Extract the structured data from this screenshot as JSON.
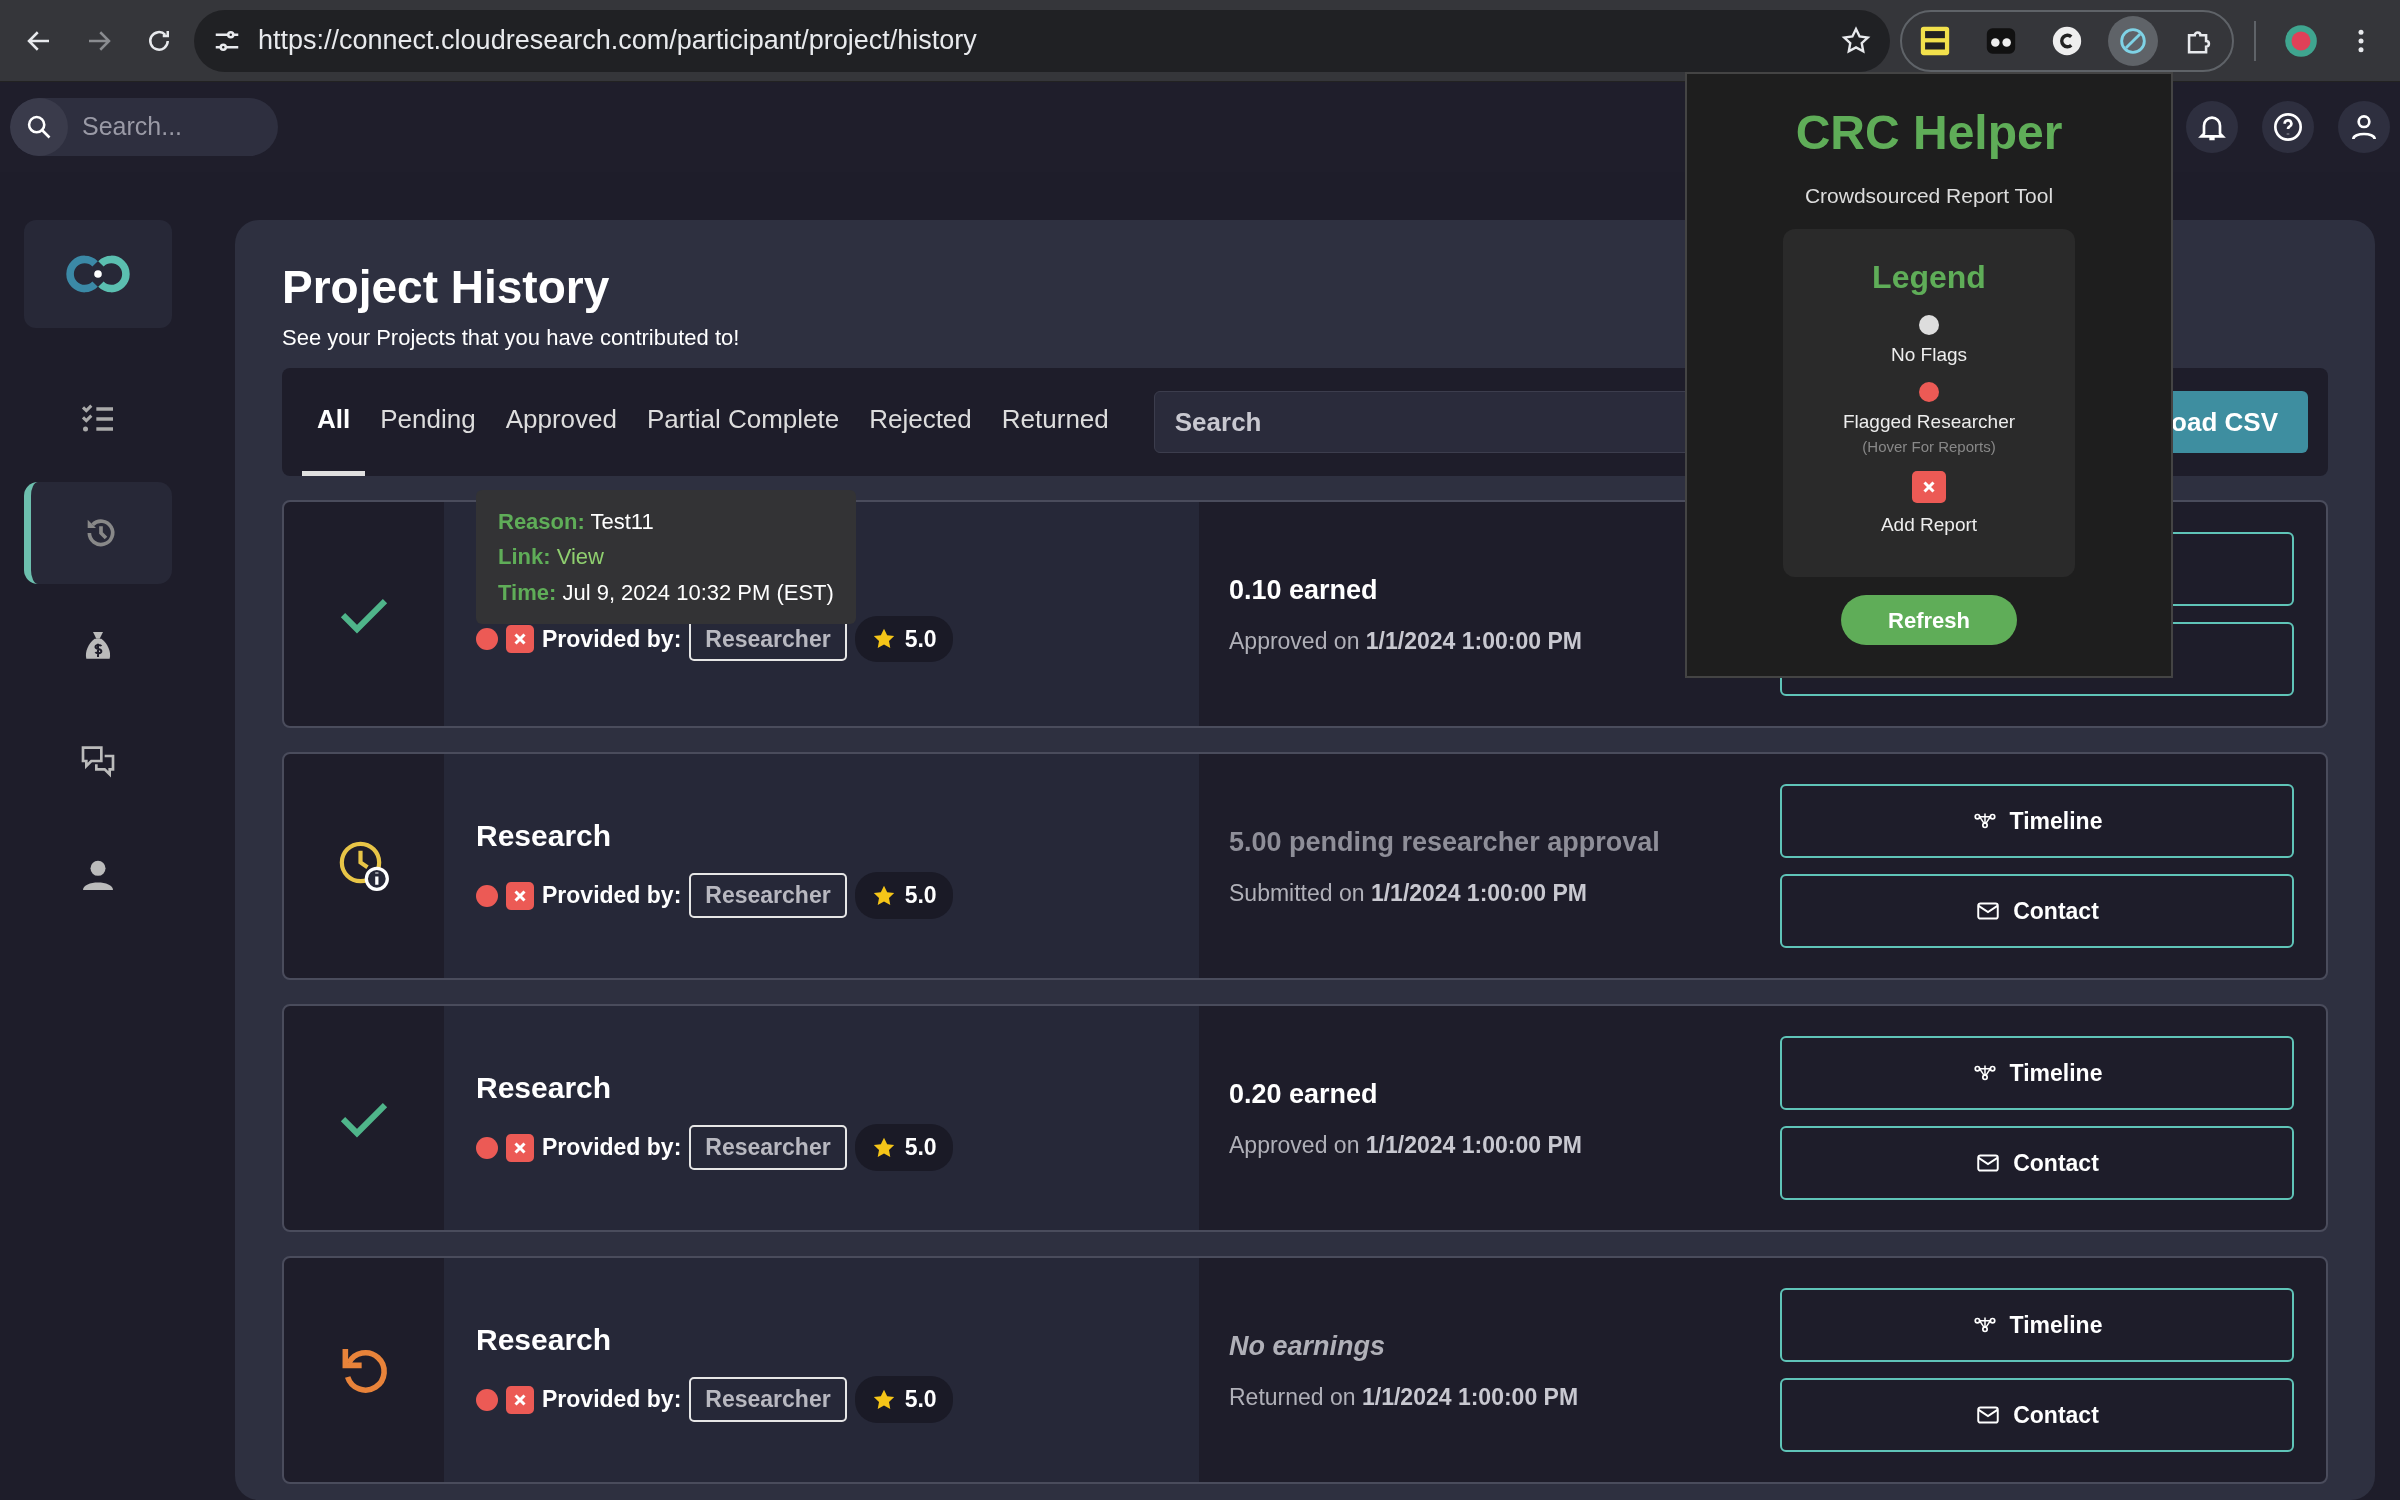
{
  "browser": {
    "url": "https://connect.cloudresearch.com/participant/project/history",
    "extensions": [
      {
        "kind": "badge",
        "selected": false
      },
      {
        "kind": "mask",
        "selected": false
      },
      {
        "kind": "letter",
        "selected": false
      },
      {
        "kind": "slash",
        "selected": true
      },
      {
        "kind": "puzzle",
        "selected": false
      }
    ]
  },
  "header": {
    "search": {
      "placeholder": "Search..."
    }
  },
  "sidebar": {
    "items": [
      {
        "kind": "tasks",
        "selected": false
      },
      {
        "kind": "history",
        "selected": true
      },
      {
        "kind": "money",
        "selected": false
      },
      {
        "kind": "chat",
        "selected": false
      },
      {
        "kind": "profile",
        "selected": false
      }
    ]
  },
  "page": {
    "title": "Project History",
    "subtitle": "See your Projects that you have contributed to!",
    "tabs": [
      {
        "label": "All",
        "selected": true
      },
      {
        "label": "Pending",
        "selected": false
      },
      {
        "label": "Approved",
        "selected": false
      },
      {
        "label": "Partial Complete",
        "selected": false
      },
      {
        "label": "Rejected",
        "selected": false
      },
      {
        "label": "Returned",
        "selected": false
      }
    ],
    "search": {
      "placeholder": "Search"
    },
    "download_button": "oad CSV",
    "projects": [
      {
        "kind": "approved",
        "flagged": true,
        "provided_label": "Provided by:",
        "provider": "Researcher",
        "rating": "5.0",
        "earnings": "0.10 earned",
        "date": "Approved on **1/1/2024 1:00:00 PM**",
        "actions": [
          {
            "kind": "timeline"
          },
          {
            "kind": "contact"
          }
        ],
        "tooltip": [
          {
            "kind": "text",
            "label": "Reason:",
            "value": "Test11"
          },
          {
            "kind": "link",
            "label": "Link:",
            "value": "View"
          },
          {
            "kind": "text",
            "label": "Time:",
            "value": "Jul 9, 2024 10:32 PM (EST)"
          }
        ]
      },
      {
        "kind": "pending",
        "title": "Research",
        "flagged": true,
        "provided_label": "Provided by:",
        "provider": "Researcher",
        "rating": "5.0",
        "earnings": "5.00 pending researcher approval",
        "date": "Submitted on **1/1/2024 1:00:00 PM**",
        "actions": [
          {
            "kind": "timeline",
            "label": "Timeline"
          },
          {
            "kind": "contact",
            "label": "Contact"
          }
        ]
      },
      {
        "kind": "approved",
        "title": "Research",
        "flagged": true,
        "provided_label": "Provided by:",
        "provider": "Researcher",
        "rating": "5.0",
        "earnings": "0.20 earned",
        "date": "Approved on **1/1/2024 1:00:00 PM**",
        "actions": [
          {
            "kind": "timeline",
            "label": "Timeline"
          },
          {
            "kind": "contact",
            "label": "Contact"
          }
        ]
      },
      {
        "kind": "returned",
        "title": "Research",
        "flagged": true,
        "provided_label": "Provided by:",
        "provider": "Researcher",
        "rating": "5.0",
        "earnings": "No earnings",
        "date": "Returned on **1/1/2024 1:00:00 PM**",
        "actions": [
          {
            "kind": "timeline",
            "label": "Timeline"
          },
          {
            "kind": "contact",
            "label": "Contact"
          }
        ]
      }
    ]
  },
  "popup": {
    "title": "CRC Helper",
    "subtitle": "Crowdsourced Report Tool",
    "legend_title": "Legend",
    "legend": [
      {
        "kind": "dot",
        "color": "#dddddd",
        "label": "No Flags"
      },
      {
        "kind": "dot",
        "color": "#ec5a55",
        "label": "Flagged Researcher",
        "note": "(Hover For Reports)"
      },
      {
        "kind": "report",
        "label": "Add Report"
      }
    ],
    "refresh_button": "Refresh"
  }
}
